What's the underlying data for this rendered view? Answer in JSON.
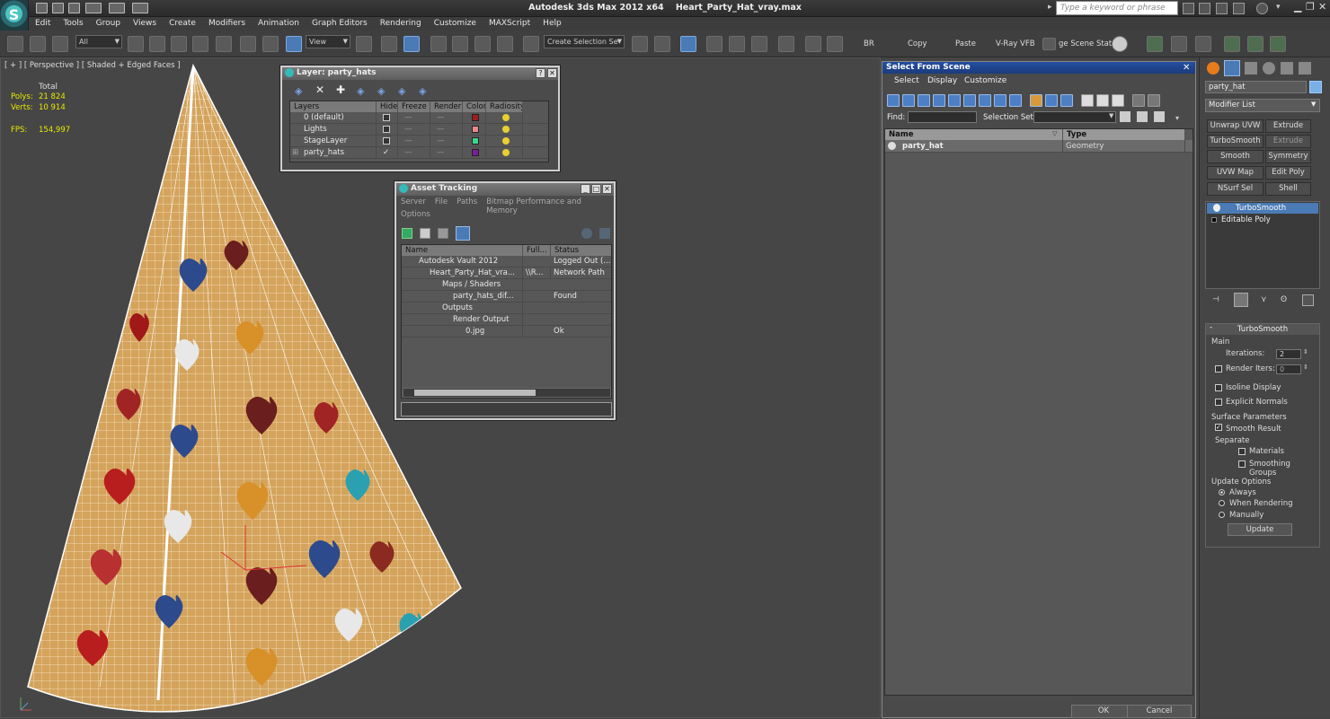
{
  "app": {
    "title": "Autodesk 3ds Max  2012 x64",
    "file": "Heart_Party_Hat_vray.max",
    "logo": "3ds-max-logo-icon",
    "search_placeholder": "Type a keyword or phrase"
  },
  "menu": [
    "Edit",
    "Tools",
    "Group",
    "Views",
    "Create",
    "Modifiers",
    "Animation",
    "Graph Editors",
    "Rendering",
    "Customize",
    "MAXScript",
    "Help"
  ],
  "toolbar": {
    "filter": "All",
    "ref_coord": "View",
    "named_sel": "Create Selection Se",
    "labels": {
      "br": "BR",
      "copy": "Copy",
      "paste": "Paste",
      "vray": "V-Ray VFB",
      "scene_state": "ge Scene Stat"
    }
  },
  "viewport": {
    "label": "[ + ] [ Perspective ] [ Shaded + Edged Faces ]",
    "stats": {
      "total": "Total",
      "polys_label": "Polys:",
      "polys": "21 824",
      "verts_label": "Verts:",
      "verts": "10 914",
      "fps_label": "FPS:",
      "fps": "154,997"
    }
  },
  "layer_window": {
    "title": "Layer: party_hats",
    "columns": [
      "Layers",
      "Hide",
      "Freeze",
      "Render",
      "Color",
      "Radiosity"
    ],
    "rows": [
      {
        "name": "0 (default)",
        "color": "#a01e1e"
      },
      {
        "name": "Lights",
        "color": "#e88a8a"
      },
      {
        "name": "StageLayer",
        "color": "#3cd68a"
      },
      {
        "name": "party_hats",
        "color": "#7a1e9a"
      }
    ]
  },
  "asset_window": {
    "title": "Asset Tracking",
    "menu": [
      "Server",
      "File",
      "Paths",
      "Bitmap Performance and Memory"
    ],
    "menu2": "Options",
    "columns": [
      "Name",
      "Full...",
      "Status"
    ],
    "rows": [
      {
        "name": "Autodesk Vault 2012",
        "full": "",
        "status": "Logged Out (..."
      },
      {
        "name": "Heart_Party_Hat_vra...",
        "full": "\\\\R...",
        "status": "Network Path"
      },
      {
        "name": "Maps / Shaders",
        "full": "",
        "status": ""
      },
      {
        "name": "party_hats_dif...",
        "full": "",
        "status": "Found"
      },
      {
        "name": "Outputs",
        "full": "",
        "status": ""
      },
      {
        "name": "Render Output",
        "full": "",
        "status": ""
      },
      {
        "name": "0.jpg",
        "full": "",
        "status": "Ok"
      }
    ]
  },
  "select_scene": {
    "title": "Select From Scene",
    "menu": [
      "Select",
      "Display",
      "Customize"
    ],
    "find_label": "Find:",
    "selset_label": "Selection Set:",
    "columns": [
      "Name",
      "Type"
    ],
    "rows": [
      {
        "name": "party_hat",
        "type": "Geometry"
      }
    ],
    "ok": "OK",
    "cancel": "Cancel"
  },
  "command_panel": {
    "object_name": "party_hat",
    "modifier_list": "Modifier List",
    "buttons": [
      "Unwrap UVW",
      "Extrude",
      "TurboSmooth",
      "Extrude",
      "Smooth",
      "Symmetry",
      "UVW Map",
      "Edit Poly",
      "NSurf Sel",
      "Shell"
    ],
    "stack": [
      "TurboSmooth",
      "Editable Poly"
    ],
    "rollout_title": "TurboSmooth",
    "main_label": "Main",
    "iterations_label": "Iterations:",
    "iterations": "2",
    "render_iters_label": "Render Iters:",
    "render_iters": "0",
    "isoline": "Isoline Display",
    "explicit_normals": "Explicit Normals",
    "surface_params": "Surface Parameters",
    "smooth_result": "Smooth Result",
    "separate": "Separate",
    "materials": "Materials",
    "smoothing_groups": "Smoothing Groups",
    "update_options": "Update Options",
    "always": "Always",
    "when_rendering": "When Rendering",
    "manually": "Manually",
    "update": "Update"
  }
}
